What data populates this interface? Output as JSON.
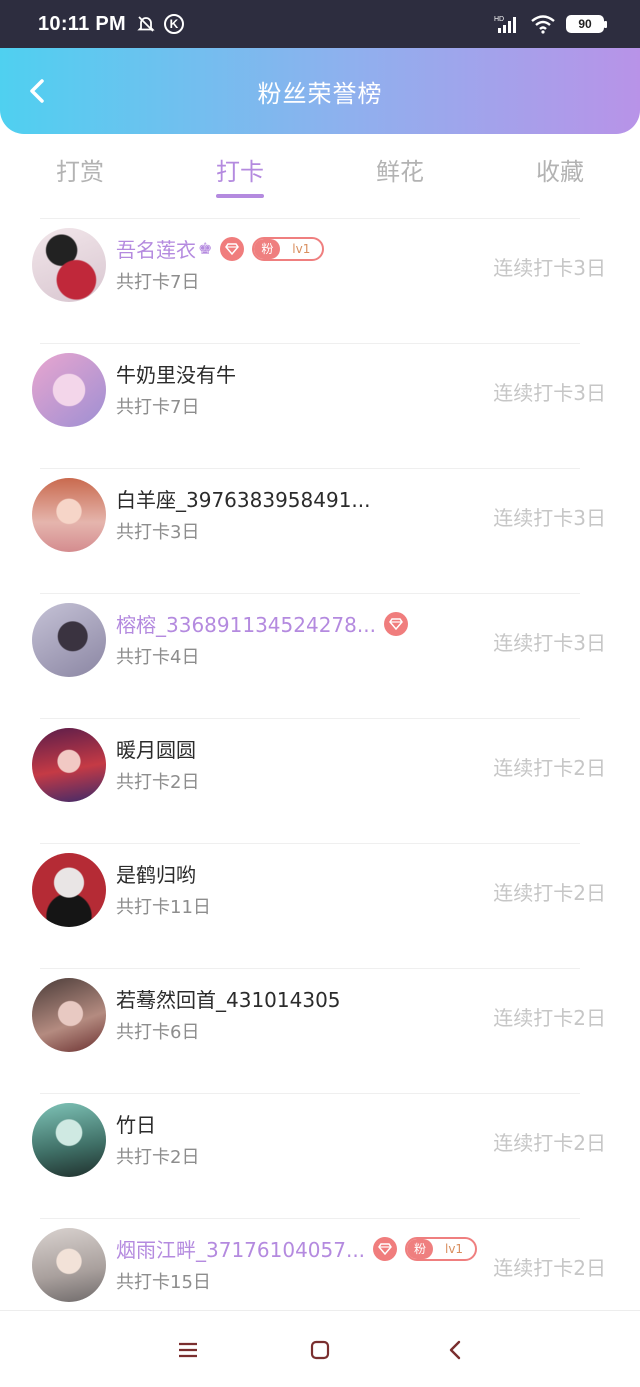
{
  "status_bar": {
    "time": "10:11 PM",
    "k_label": "K",
    "network": "HD",
    "battery": "90"
  },
  "header": {
    "title": "粉丝荣誉榜"
  },
  "tabs": [
    {
      "label": "打赏"
    },
    {
      "label": "打卡"
    },
    {
      "label": "鲜花"
    },
    {
      "label": "收藏"
    }
  ],
  "active_tab": "打卡",
  "fan_badge": {
    "label": "粉",
    "level": "lv1"
  },
  "rows": [
    {
      "name": "吾名莲衣",
      "sub": "共打卡7日",
      "streak": "连续打卡3日"
    },
    {
      "name": "牛奶里没有牛",
      "sub": "共打卡7日",
      "streak": "连续打卡3日"
    },
    {
      "name": "白羊座_3976383958491...",
      "sub": "共打卡3日",
      "streak": "连续打卡3日"
    },
    {
      "name": "榕榕_336891134524278...",
      "sub": "共打卡4日",
      "streak": "连续打卡3日"
    },
    {
      "name": "暖月圆圆",
      "sub": "共打卡2日",
      "streak": "连续打卡2日"
    },
    {
      "name": "是鹤归哟",
      "sub": "共打卡11日",
      "streak": "连续打卡2日"
    },
    {
      "name": "若蓦然回首_431014305",
      "sub": "共打卡6日",
      "streak": "连续打卡2日"
    },
    {
      "name": "竹日",
      "sub": "共打卡2日",
      "streak": "连续打卡2日"
    },
    {
      "name": "烟雨江畔_37176104057...",
      "sub": "共打卡15日",
      "streak": "连续打卡2日"
    }
  ],
  "colors": {
    "accent": "#b48adf",
    "badge_red": "#ef7f7f",
    "header_start": "#4fd0f0",
    "header_end": "#b893e8"
  },
  "icons": [
    "back-icon",
    "silent-bell-icon",
    "signal-icon",
    "wifi-icon",
    "battery-icon",
    "diamond-icon",
    "crown-icon",
    "menu-icon",
    "home-icon",
    "nav-back-icon"
  ]
}
